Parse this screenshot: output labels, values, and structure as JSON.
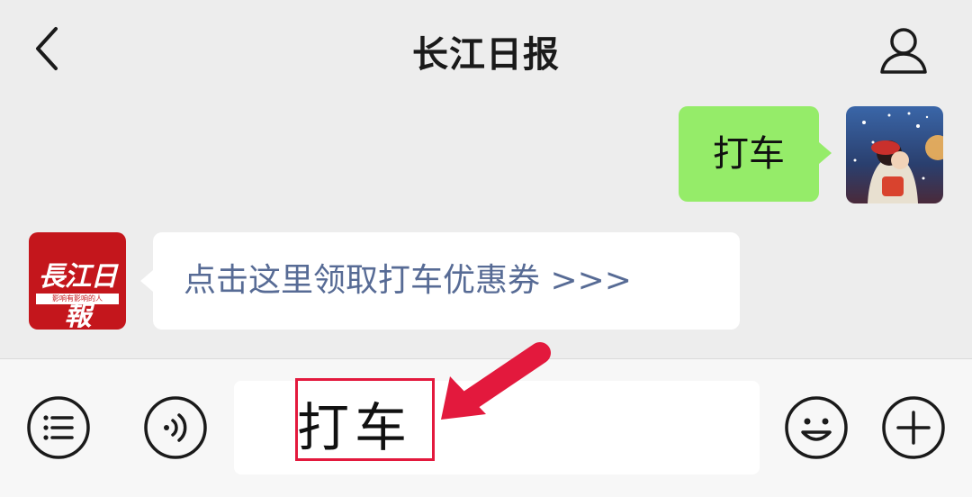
{
  "header": {
    "title": "长江日报"
  },
  "messages": [
    {
      "side": "right",
      "text": "打车"
    },
    {
      "side": "left",
      "text": "点击这里领取打车优惠券 >>>"
    }
  ],
  "brand_avatar": {
    "logo_text": "長江日報",
    "tagline": "影响有影响的人",
    "color": "#c4161c"
  },
  "input": {
    "value": "打车"
  },
  "icons": [
    "back-arrow-icon",
    "profile-icon",
    "menu-list-icon",
    "voice-icon",
    "emoji-icon",
    "add-icon"
  ],
  "colors": {
    "right_bubble": "#95ec69",
    "link": "#576b95",
    "highlight": "#e3193d"
  }
}
